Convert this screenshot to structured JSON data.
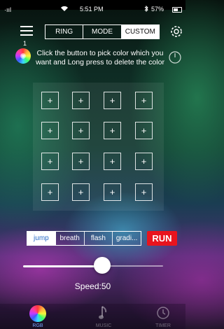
{
  "status_bar": {
    "signal": "·ııl",
    "time": "5:51 PM",
    "battery": "57%"
  },
  "header": {
    "menu_badge": "1",
    "tabs": [
      {
        "label": "RING",
        "active": false
      },
      {
        "label": "MODE",
        "active": false
      },
      {
        "label": "CUSTOM",
        "active": true
      }
    ]
  },
  "instruction": "Click the button to pick color which you want and Long press to delete the color",
  "color_grid": {
    "rows": 4,
    "cols": 4,
    "cell_symbol": "+"
  },
  "modes": [
    {
      "label": "jump",
      "active": true
    },
    {
      "label": "breath",
      "active": false
    },
    {
      "label": "flash",
      "active": false
    },
    {
      "label": "gradi...",
      "active": false
    }
  ],
  "run_label": "RUN",
  "speed": {
    "label": "Speed:50",
    "value": 50,
    "max": 100
  },
  "bottom_tabs": [
    {
      "label": "RGB",
      "icon": "color-wheel-icon",
      "active": true
    },
    {
      "label": "MUSIC",
      "icon": "music-note-icon",
      "active": false
    },
    {
      "label": "TIMER",
      "icon": "timer-icon",
      "active": false
    }
  ],
  "colors": {
    "run": "#e8141e",
    "active_tab_text": "#2a6cc8",
    "active_bottom_tab": "#7aa7ff"
  }
}
